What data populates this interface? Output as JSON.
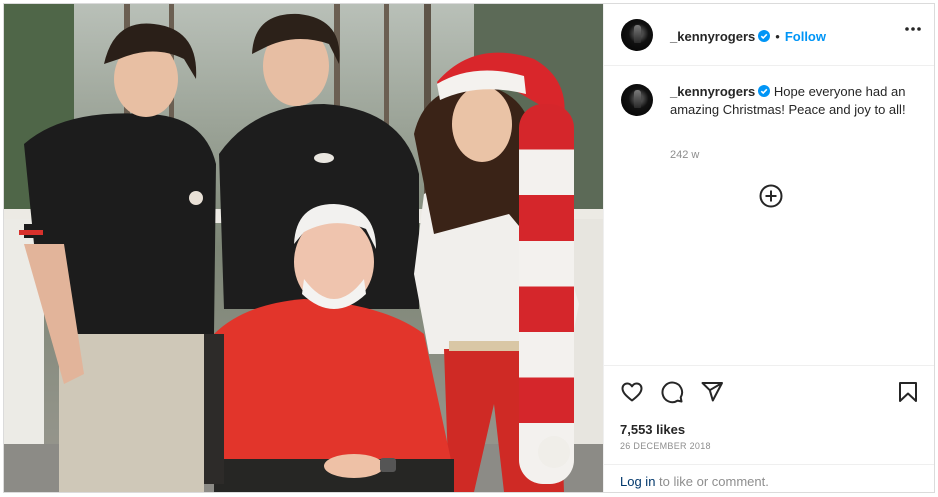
{
  "post": {
    "username": "_kennyrogers",
    "follow_label": "Follow",
    "dot": "•",
    "caption": "Hope everyone had an amazing Christmas! Peace and joy to all!",
    "age": "242 w",
    "likes": "7,553 likes",
    "date": "26 DECEMBER 2018"
  },
  "footer": {
    "login_label": "Log in",
    "rest": " to like or comment."
  },
  "icons": {
    "verified": "verified-badge-icon",
    "more": "more-options-icon",
    "add": "add-comment-plus-icon",
    "like": "heart-icon",
    "comment": "comment-icon",
    "share": "share-icon",
    "save": "bookmark-icon"
  },
  "colors": {
    "accent": "#0095f6",
    "link": "#00376b",
    "muted": "#8e8e8e",
    "border": "#dbdbdb"
  }
}
